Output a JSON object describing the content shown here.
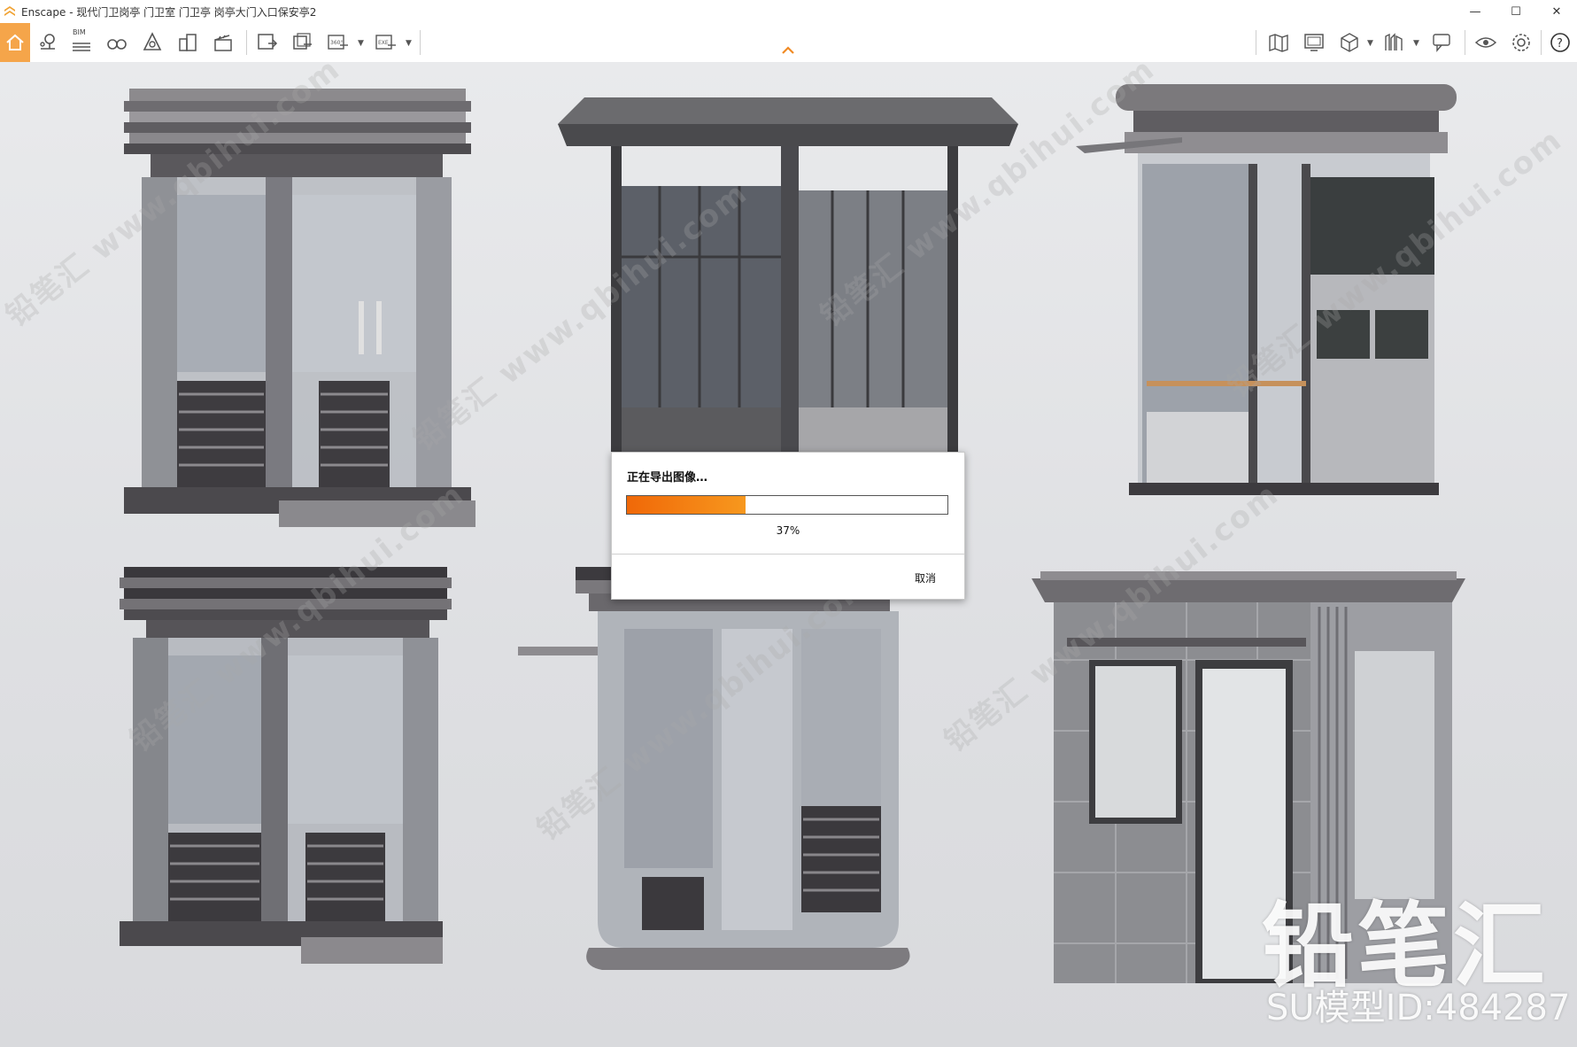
{
  "window": {
    "app_name": "Enscape",
    "title": "Enscape - 现代门卫岗亭 门卫室 门卫亭 岗亭大门入口保安亭2"
  },
  "toolbar": {
    "bim_label": "BIM",
    "left_tools": [
      "home-icon",
      "asset-pin-icon",
      "bim-icon",
      "binoculars-icon",
      "light-view-icon",
      "buildings-icon",
      "clapper-icon",
      "export-image-icon",
      "batch-export-icon",
      "panorama-360-icon",
      "exe-export-icon"
    ],
    "right_tools": [
      "map-icon",
      "screen-icon",
      "cube-icon",
      "library-icon",
      "feedback-icon",
      "visual-settings-icon",
      "settings-icon",
      "help-icon"
    ]
  },
  "export_dialog": {
    "title": "正在导出图像…",
    "progress": 0.37,
    "progress_label": "37%",
    "cancel_label": "取消"
  },
  "watermark": {
    "logo_text": "铅笔汇",
    "model_id_text": "SU模型ID:484287",
    "tile_text": "铅笔汇 www.qbihui.com"
  },
  "colors": {
    "accent": "#f5a54a",
    "progress": "#f06808"
  }
}
